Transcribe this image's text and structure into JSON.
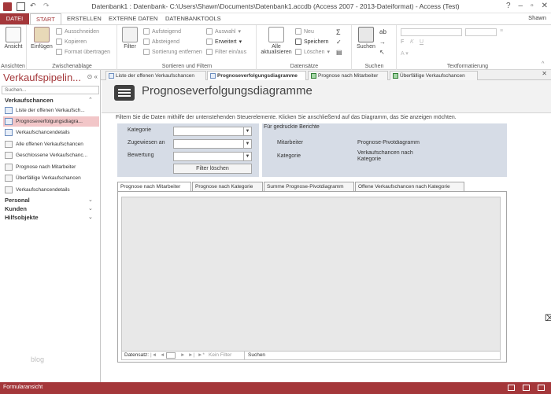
{
  "titlebar": {
    "title": "Datenbank1 : Datenbank- C:\\Users\\Shawn\\Documents\\Datenbank1.accdb (Access 2007 - 2013-Dateiformat) - Access (Test)",
    "user": "Shawn"
  },
  "ribbon_tabs": {
    "file": "DATEI",
    "start": "START",
    "create": "ERSTELLEN",
    "external": "EXTERNE DATEN",
    "dbtools": "DATENBANKTOOLS"
  },
  "ribbon": {
    "views": {
      "view": "Ansicht",
      "label": "Ansichten"
    },
    "clipboard": {
      "paste": "Einfügen",
      "cut": "Ausschneiden",
      "copy": "Kopieren",
      "format": "Format übertragen",
      "label": "Zwischenablage"
    },
    "sort": {
      "filter": "Filter",
      "asc": "Aufsteigend",
      "desc": "Absteigend",
      "remove": "Sortierung entfernen",
      "selection": "Auswahl",
      "advanced": "Erweitert",
      "toggle": "Filter ein/aus",
      "label": "Sortieren und Filtern"
    },
    "records": {
      "refresh_all": "Alle",
      "refresh_all2": "aktualisieren",
      "new": "Neu",
      "save": "Speichern",
      "delete": "Löschen",
      "label": "Datensätze"
    },
    "find": {
      "search": "Suchen",
      "label": "Suchen"
    },
    "textformat": {
      "label": "Textformatierung"
    }
  },
  "nav": {
    "title": "Verkaufspipelin...",
    "search_placeholder": "Suchen...",
    "section_main": "Verkaufschancen",
    "items": [
      {
        "label": "Liste der offenen Verkaufsch...",
        "type": "form"
      },
      {
        "label": "Prognoseverfolgungsdiagra...",
        "type": "form"
      },
      {
        "label": "Verkaufschancendetails",
        "type": "form"
      },
      {
        "label": "Alle offenen Verkaufschancen",
        "type": "report"
      },
      {
        "label": "Geschlossene Verkaufschanc...",
        "type": "report"
      },
      {
        "label": "Prognose nach Mitarbeiter",
        "type": "report"
      },
      {
        "label": "Überfällige Verkaufschancen",
        "type": "report"
      },
      {
        "label": "Verkaufschancendetails",
        "type": "report"
      }
    ],
    "section_personal": "Personal",
    "section_customers": "Kunden",
    "section_helpers": "Hilfsobjekte"
  },
  "doc_tabs": [
    "Liste der offenen Verkaufschancen",
    "Prognoseverfolgungsdiagramme",
    "Prognose nach Mitarbeiter",
    "Überfällige Verkaufschancen"
  ],
  "form": {
    "title": "Prognoseverfolgungsdiagramme",
    "instructions": "Filtern Sie die Daten mithilfe der untenstehenden Steuerelemente. Klicken Sie anschließend auf das Diagramm, das Sie anzeigen möchten.",
    "filter": {
      "category_label": "Kategorie",
      "assigned_label": "Zugewiesen an",
      "rating_label": "Bewertung",
      "clear_button": "Filter löschen"
    },
    "print": {
      "title": "Für gedruckte Berichte",
      "employee_label": "Mitarbeiter",
      "employee_value": "Prognose-Pivotdiagramm",
      "category_label": "Kategorie",
      "category_value": "Verkaufschancen nach Kategorie"
    },
    "subtabs": [
      "Prognose nach Mitarbeiter",
      "Prognose nach Kategorie",
      "Summe Prognose-Pivotdiagramm",
      "Offene Verkaufschancen nach Kategorie"
    ],
    "record_nav": {
      "label": "Datensatz:",
      "first": "|◄",
      "prev": "◄",
      "next": "►",
      "last": "►|",
      "new": "►*",
      "filter": "Kein Filter",
      "search": "Suchen"
    }
  },
  "status": {
    "text": "Formularansicht"
  },
  "watermark": "blog"
}
